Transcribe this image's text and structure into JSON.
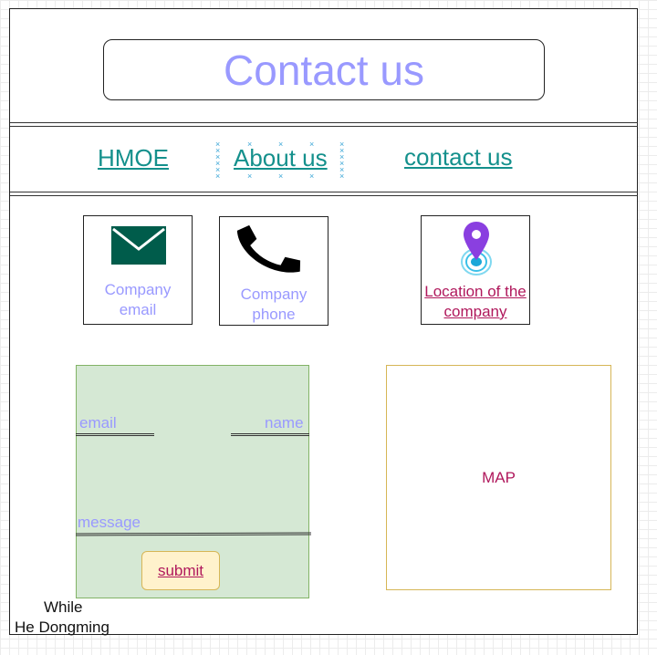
{
  "header": {
    "title": "Contact us"
  },
  "nav": {
    "items": [
      {
        "label": "HMOE"
      },
      {
        "label": "About us"
      },
      {
        "label": "contact us"
      }
    ]
  },
  "cards": {
    "email": {
      "label_line1": "Company",
      "label_line2": "email",
      "icon": "envelope-icon"
    },
    "phone": {
      "label_line1": "Company",
      "label_line2": "phone",
      "icon": "phone-icon"
    },
    "location": {
      "label_line1": "Location of the",
      "label_line2": "company",
      "icon": "location-pin-icon"
    }
  },
  "form": {
    "email_label": "email",
    "name_label": "name",
    "message_label": "message",
    "submit_label": "submit"
  },
  "map": {
    "label": "MAP"
  },
  "footer": {
    "line1": "While",
    "line2": "He Dongming"
  },
  "colors": {
    "title": "#9999ff",
    "nav_link": "#14908c",
    "link_pink": "#b0185c",
    "form_fill": "#d5e8d4",
    "submit_fill": "#fff2cc",
    "envelope": "#005c4b",
    "pin": "#8a3fe0"
  }
}
